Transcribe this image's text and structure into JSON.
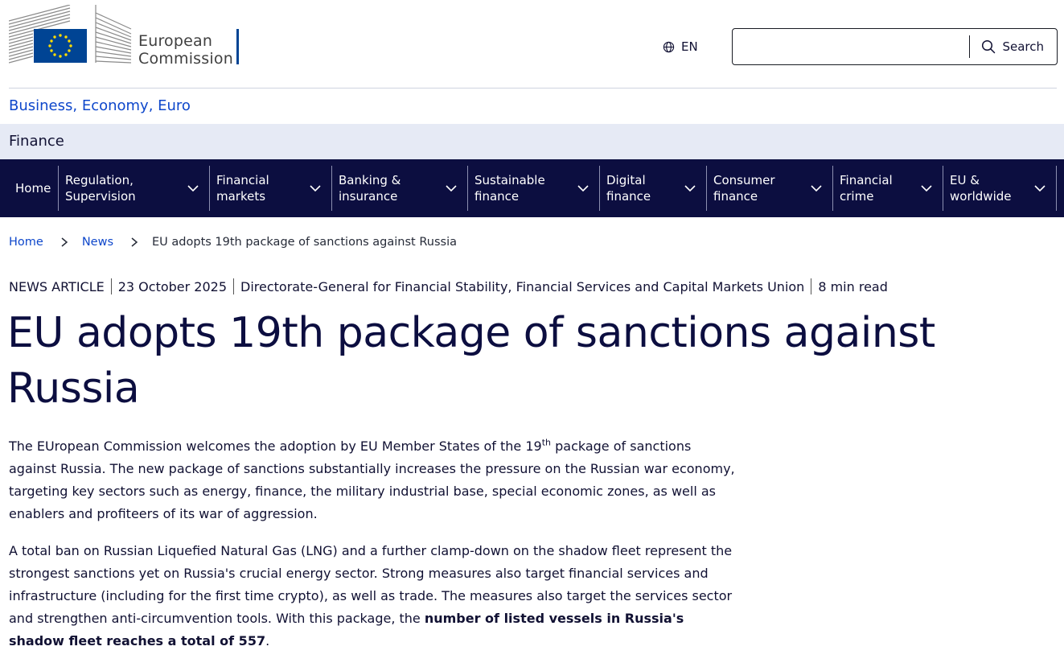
{
  "header": {
    "logo_line1": "European",
    "logo_line2": "Commission",
    "language": "EN",
    "search_placeholder": "",
    "search_label": "Search"
  },
  "site": {
    "name": "Business, Economy, Euro",
    "section": "Finance"
  },
  "nav": [
    {
      "label": "Home",
      "dropdown": false
    },
    {
      "label": "Regulation, Supervision",
      "dropdown": true
    },
    {
      "label": "Financial markets",
      "dropdown": true
    },
    {
      "label": "Banking & insurance",
      "dropdown": true
    },
    {
      "label": "Sustainable finance",
      "dropdown": true
    },
    {
      "label": "Digital finance",
      "dropdown": true
    },
    {
      "label": "Consumer finance",
      "dropdown": true
    },
    {
      "label": "Financial crime",
      "dropdown": true
    },
    {
      "label": "EU & worldwide",
      "dropdown": true
    }
  ],
  "breadcrumb": {
    "home": "Home",
    "news": "News",
    "current": "EU adopts 19th package of sanctions against Russia"
  },
  "meta": {
    "type": "NEWS ARTICLE",
    "date": "23 October 2025",
    "department": "Directorate-General for Financial Stability, Financial Services and Capital Markets Union",
    "read_time": "8 min read"
  },
  "article": {
    "title": "EU adopts 19th package of sanctions against Russia",
    "p1_a": "The EUropean Commission welcomes the adoption by EU Member States of the 19",
    "p1_sup": "th",
    "p1_b": " package of sanctions against Russia. The new package of sanctions substantially increases the pressure on the Russian war economy, targeting key sectors such as energy, finance, the military industrial base, special economic zones, as well as enablers and profiteers of its war of aggression.",
    "p2_a": "A total ban on Russian Liquefied Natural Gas (LNG) and a further clamp-down on the shadow fleet represent the strongest sanctions yet on Russia's crucial energy sector. Strong measures also target financial services and infrastructure (including for the first time crypto), as well as trade. The measures also target the services sector and strengthen anti-circumvention tools. With this package, the ",
    "p2_bold": "number of listed vessels in Russia's shadow fleet reaches a total of 557",
    "p2_end": "."
  },
  "colors": {
    "nav_bg": "#0c0e40",
    "link": "#0e47cb",
    "finance_bar": "#e6eaf5",
    "eu_blue": "#004494",
    "eu_yellow": "#ffdd00"
  }
}
